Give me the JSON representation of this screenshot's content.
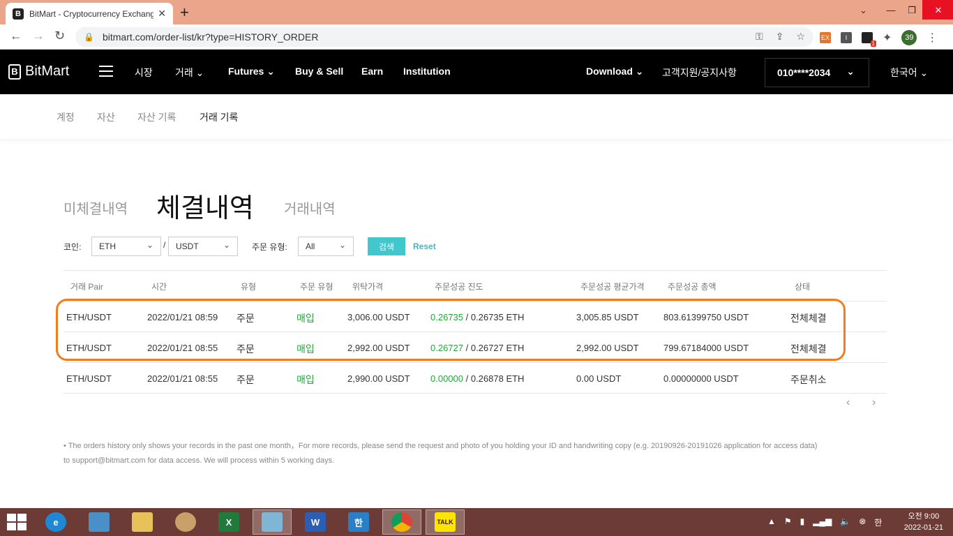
{
  "browser": {
    "tab_title": "BitMart - Cryptocurrency Exchang",
    "url": "bitmart.com/order-list/kr?type=HISTORY_ORDER",
    "profile_count": "39",
    "ext_badge": "1"
  },
  "header": {
    "logo": "BitMart",
    "nav": [
      "시장",
      "거래",
      "Futures",
      "Buy & Sell",
      "Earn",
      "Institution"
    ],
    "download": "Download",
    "support": "고객지원/공지사항",
    "account": "010****2034",
    "language": "한국어"
  },
  "subnav": [
    "계정",
    "자산",
    "자산 기록",
    "거래 기록"
  ],
  "tabs": [
    "미체결내역",
    "체결내역",
    "거래내역"
  ],
  "filters": {
    "coin_label": "코인:",
    "base": "ETH",
    "quote": "USDT",
    "type_label": "주문 유형:",
    "type_value": "All",
    "search_btn": "검색",
    "reset": "Reset"
  },
  "table": {
    "headers": [
      "거래 Pair",
      "시간",
      "유형",
      "주문 유형",
      "위탁가격",
      "주문성공 진도",
      "주문성공 평균가격",
      "주문성공 총액",
      "상태"
    ],
    "rows": [
      {
        "pair": "ETH/USDT",
        "time": "2022/01/21 08:59",
        "type": "주문",
        "side": "매입",
        "price": "3,006.00 USDT",
        "filled": "0.26735",
        "total_qty": " / 0.26735 ETH",
        "avg": "3,005.85 USDT",
        "amount": "803.61399750 USDT",
        "status": "전체체결"
      },
      {
        "pair": "ETH/USDT",
        "time": "2022/01/21 08:55",
        "type": "주문",
        "side": "매입",
        "price": "2,992.00 USDT",
        "filled": "0.26727",
        "total_qty": " / 0.26727 ETH",
        "avg": "2,992.00 USDT",
        "amount": "799.67184000 USDT",
        "status": "전체체결"
      },
      {
        "pair": "ETH/USDT",
        "time": "2022/01/21 08:55",
        "type": "주문",
        "side": "매입",
        "price": "2,990.00 USDT",
        "filled": "0.00000",
        "total_qty": " / 0.26878 ETH",
        "avg": "0.00 USDT",
        "amount": "0.00000000 USDT",
        "status": "주문취소"
      }
    ]
  },
  "note": {
    "line1": "•  The orders history only shows your records in the past one month，For more records, please send the request and photo of you holding your ID and handwriting copy (e.g. 20190926-20191026 application for access data)",
    "line2": "to support@bitmart.com for data access. We will process within 5 working days."
  },
  "taskbar": {
    "clock_time": "오전 9:00",
    "clock_date": "2022-01-21",
    "ime": "한",
    "apps": [
      "ie-icon",
      "control-panel-icon",
      "file-explorer-icon",
      "paint-icon",
      "excel-icon",
      "notepad-icon",
      "word-icon",
      "hangul-icon",
      "chrome-icon",
      "kakaotalk-icon"
    ]
  },
  "colors": {
    "accent_teal": "#41c7cc",
    "buy_green": "#23a63a",
    "highlight_orange": "#f07d1e",
    "tabbar": "#eaa58a",
    "taskbar": "#6d3b35"
  }
}
